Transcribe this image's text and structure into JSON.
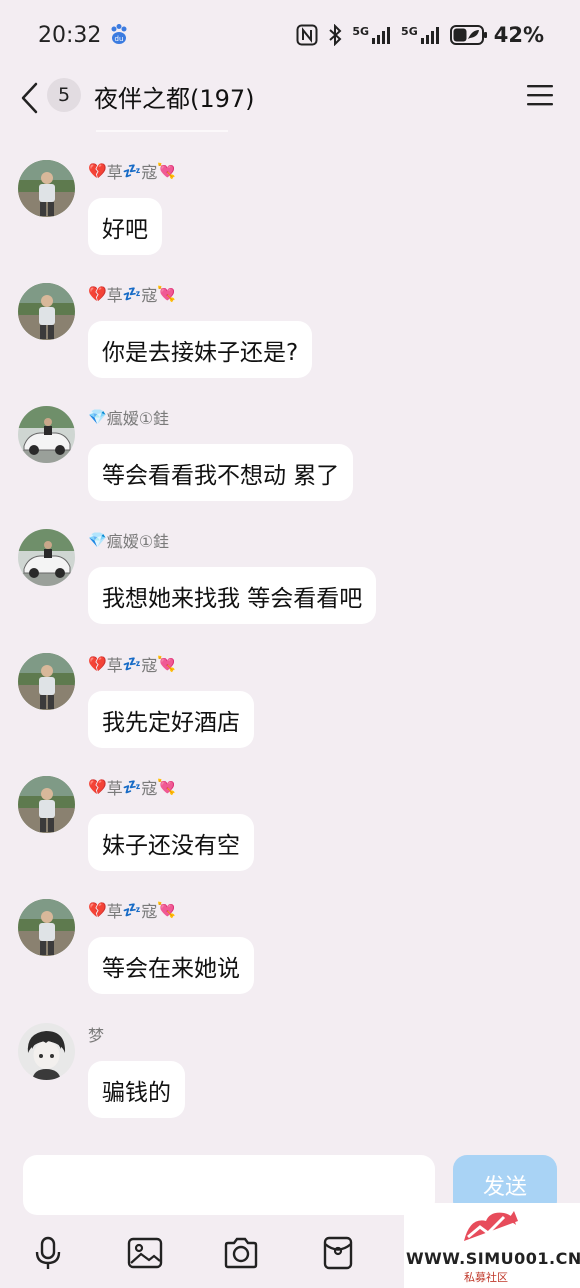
{
  "status_bar": {
    "time": "20:32",
    "signal1_label": "5G",
    "signal2_label": "5G",
    "battery_percent": "42%",
    "icons": [
      "baidu-paw-icon",
      "nfc-icon",
      "bluetooth-icon",
      "signal-icon",
      "signal-icon",
      "battery-icon"
    ]
  },
  "header": {
    "unread_count": "5",
    "title": "夜伴之都(197)"
  },
  "messages": [
    {
      "sender": "草寇",
      "sender_prefix_emoji": "💔",
      "sender_mid_emoji": "💤",
      "sender_suffix_emoji": "💘",
      "text": "好吧",
      "avatar": "man-avatar"
    },
    {
      "sender": "草寇",
      "sender_prefix_emoji": "💔",
      "sender_mid_emoji": "💤",
      "sender_suffix_emoji": "💘",
      "text": "你是去接妹子还是?",
      "avatar": "man-avatar"
    },
    {
      "sender": "瘋嫒①銈",
      "sender_prefix_emoji": "💎",
      "text": "等会看看我不想动 累了",
      "avatar": "car-avatar"
    },
    {
      "sender": "瘋嫒①銈",
      "sender_prefix_emoji": "💎",
      "text": "我想她来找我 等会看看吧",
      "avatar": "car-avatar"
    },
    {
      "sender": "草寇",
      "sender_prefix_emoji": "💔",
      "sender_mid_emoji": "💤",
      "sender_suffix_emoji": "💘",
      "text": "我先定好酒店",
      "avatar": "man-avatar"
    },
    {
      "sender": "草寇",
      "sender_prefix_emoji": "💔",
      "sender_mid_emoji": "💤",
      "sender_suffix_emoji": "💘",
      "text": "妹子还没有空",
      "avatar": "man-avatar"
    },
    {
      "sender": "草寇",
      "sender_prefix_emoji": "💔",
      "sender_mid_emoji": "💤",
      "sender_suffix_emoji": "💘",
      "text": "等会在来她说",
      "avatar": "man-avatar"
    },
    {
      "sender": "梦",
      "text": "骗钱的",
      "avatar": "anime-avatar"
    }
  ],
  "input": {
    "send_label": "发送",
    "value": ""
  },
  "toolbar": [
    "microphone-icon",
    "image-icon",
    "camera-icon",
    "red-packet-icon"
  ],
  "watermark": {
    "text": "WWW.SIMU001.CN",
    "subtext": "私募社区"
  },
  "colors": {
    "background": "#f3edf2",
    "bubble": "#ffffff",
    "send_button": "#a9d3f5",
    "sender_name": "#7a7a7a"
  }
}
